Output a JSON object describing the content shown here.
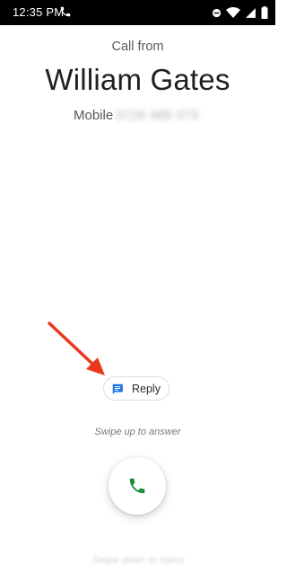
{
  "status_bar": {
    "time": "12:35 PM",
    "icons": [
      "phone-call-icon",
      "dnd-icon",
      "wifi-icon",
      "signal-icon",
      "battery-icon"
    ]
  },
  "caller": {
    "heading": "Call from",
    "name": "William Gates",
    "label": "Mobile",
    "number": "0726 486 473"
  },
  "actions": {
    "reply_label": "Reply",
    "reply_icon": "message-icon",
    "swipe_up_hint": "Swipe up to answer",
    "answer_icon": "phone-icon",
    "swipe_down_hint": "Swipe down to reject"
  },
  "colors": {
    "status_bar": "#000000",
    "background": "#ffffff",
    "reply_icon": "#1a73e8",
    "answer_icon": "#1e8e3e",
    "annotation_arrow": "#e8391d"
  }
}
